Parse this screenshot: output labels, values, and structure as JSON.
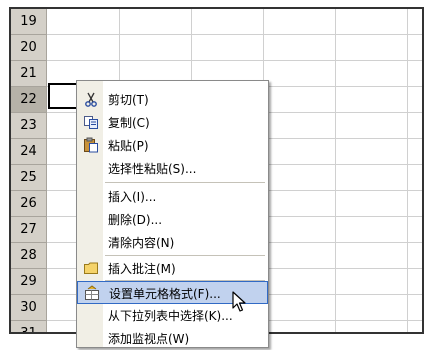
{
  "rows": [
    "19",
    "20",
    "21",
    "22",
    "23",
    "24",
    "25",
    "26",
    "27",
    "28",
    "29",
    "30",
    "31"
  ],
  "active_row": "22",
  "menu": {
    "items": [
      {
        "id": "cut",
        "label": "剪切(T)",
        "icon": "scissors-icon"
      },
      {
        "id": "copy",
        "label": "复制(C)",
        "icon": "copy-icon"
      },
      {
        "id": "paste",
        "label": "粘贴(P)",
        "icon": "paste-icon"
      },
      {
        "id": "paste-special",
        "label": "选择性粘贴(S)...",
        "icon": ""
      },
      {
        "id": "insert",
        "label": "插入(I)...",
        "icon": ""
      },
      {
        "id": "delete",
        "label": "删除(D)...",
        "icon": ""
      },
      {
        "id": "clear-contents",
        "label": "清除内容(N)",
        "icon": ""
      },
      {
        "id": "insert-comment",
        "label": "插入批注(M)",
        "icon": "comment-icon"
      },
      {
        "id": "format-cells",
        "label": "设置单元格格式(F)...",
        "icon": "format-cells-icon",
        "highlighted": true
      },
      {
        "id": "pick-from-list",
        "label": "从下拉列表中选择(K)...",
        "icon": ""
      },
      {
        "id": "add-watch",
        "label": "添加监视点(W)",
        "icon": ""
      }
    ]
  }
}
